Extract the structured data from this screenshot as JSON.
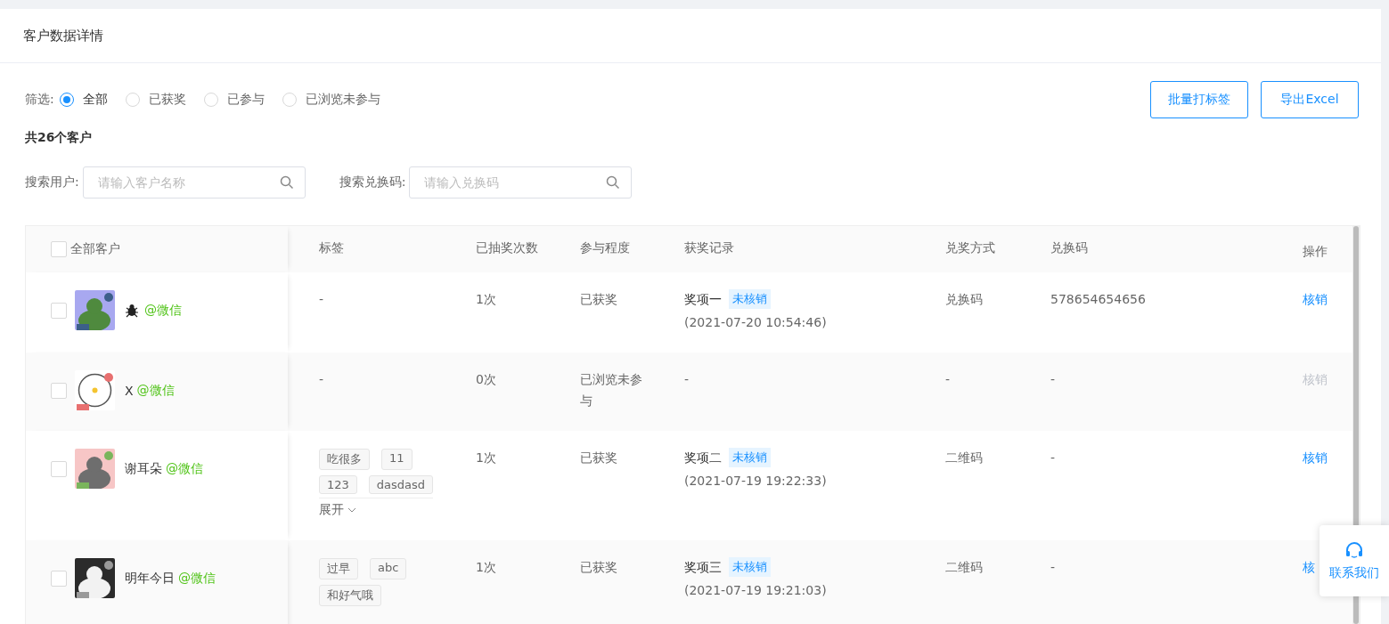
{
  "page_title": "客户数据详情",
  "filter": {
    "label": "筛选:",
    "options": [
      {
        "label": "全部",
        "selected": true
      },
      {
        "label": "已获奖",
        "selected": false
      },
      {
        "label": "已参与",
        "selected": false
      },
      {
        "label": "已浏览未参与",
        "selected": false
      }
    ]
  },
  "buttons": [
    "批量打标签",
    "导出Excel"
  ],
  "count": "共26个客户",
  "searches": [
    {
      "label": "搜索用户:",
      "placeholder": "请输入客户名称"
    },
    {
      "label": "搜索兑换码:",
      "placeholder": "请输入兑换码"
    }
  ],
  "table": {
    "select_all": {
      "label": "全部客户",
      "checked": false
    },
    "columns": [
      "标签",
      "已抽奖次数",
      "参与程度",
      "获奖记录",
      "兑奖方式",
      "兑换码",
      "操作"
    ],
    "rows": [
      {
        "checked": false,
        "avatar": {
          "kind": "picture"
        },
        "channel": "@微信",
        "tags": [],
        "tags_empty": "-",
        "draws": "1次",
        "participation": "已获奖",
        "record": {
          "prize": "奖项一",
          "status": "未核销",
          "time": "(2021-07-20 10:54:46)"
        },
        "method": "兑换码",
        "code": "578654654656",
        "action": {
          "label": "核销",
          "disabled": false
        }
      },
      {
        "checked": false,
        "avatar": {
          "kind": "picture"
        },
        "name": "X",
        "channel": "@微信",
        "tags": [],
        "tags_empty": "-",
        "draws": "0次",
        "participation": "已浏览未参与",
        "record": {
          "empty": "-"
        },
        "method": "-",
        "code": "-",
        "action": {
          "label": "核销",
          "disabled": true
        }
      },
      {
        "checked": false,
        "avatar": {
          "kind": "picture"
        },
        "name": "谢耳朵",
        "channel": "@微信",
        "tags": [
          "吃很多",
          "11",
          "123",
          "dasdasd"
        ],
        "expand": "展开",
        "draws": "1次",
        "participation": "已获奖",
        "record": {
          "prize": "奖项二",
          "status": "未核销",
          "time": "(2021-07-19 19:22:33)"
        },
        "method": "二维码",
        "code": "-",
        "action": {
          "label": "核销",
          "disabled": false
        }
      },
      {
        "checked": false,
        "avatar": {
          "kind": "picture"
        },
        "name": "明年今日",
        "channel": "@微信",
        "tags": [
          "过早",
          "abc",
          "和好气哦"
        ],
        "draws": "1次",
        "participation": "已获奖",
        "record": {
          "prize": "奖项三",
          "status": "未核销",
          "time": "(2021-07-19 19:21:03)"
        },
        "method": "二维码",
        "code": "-",
        "action": {
          "label": "核",
          "disabled": false
        }
      }
    ]
  },
  "contact": {
    "label": "联系我们"
  }
}
